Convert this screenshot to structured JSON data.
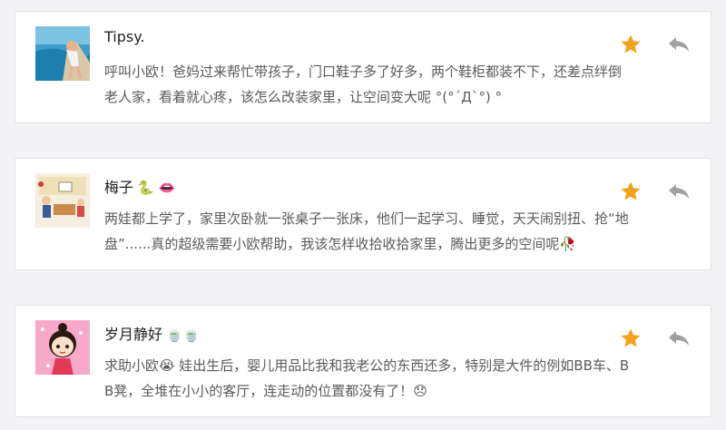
{
  "colors": {
    "star": "#f2a21b",
    "reply": "#a0a0a0",
    "card_border": "#e1e1e4",
    "text": "#5a5a5a"
  },
  "comments": [
    {
      "name": "Tipsy.",
      "name_emoji": "",
      "text": "呼叫小欧！爸妈过来帮忙带孩子，门口鞋子多了好多，两个鞋柜都装不下，还差点绊倒\n老人家，看着就心疼，该怎么改装家里，让空间变大呢 °(°ˊДˋ°) °",
      "avatar": "beach-photo",
      "starred": true
    },
    {
      "name": "梅子",
      "name_emoji": "🐍 👄",
      "text": "两娃都上学了，家里次卧就一张桌子一张床，他们一起学习、睡觉，天天闹别扭、抢“地\n盘”......真的超级需要小欧帮助，我该怎样收拾收拾家里，腾出更多的空间呢🥀",
      "avatar": "cartoon-family",
      "starred": true
    },
    {
      "name": "岁月静好",
      "name_emoji": "🍵🍵",
      "text": "求助小欧😭 娃出生后，婴儿用品比我和我老公的东西还多，特别是大件的例如BB车、B\nB凳，全堆在小小的客厅，连走动的位置都没有了！😞",
      "avatar": "cartoon-girl",
      "starred": true
    }
  ]
}
